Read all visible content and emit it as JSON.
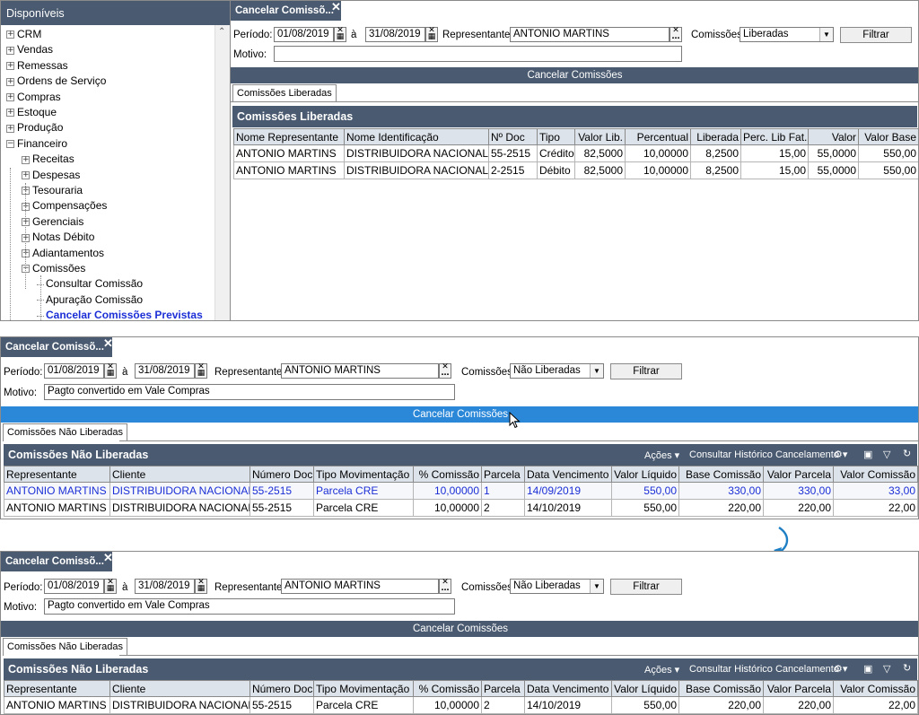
{
  "tree": {
    "header": "Disponíveis",
    "items": [
      {
        "label": "CRM",
        "level": 0,
        "exp": "+"
      },
      {
        "label": "Vendas",
        "level": 0,
        "exp": "+"
      },
      {
        "label": "Remessas",
        "level": 0,
        "exp": "+"
      },
      {
        "label": "Ordens de Serviço",
        "level": 0,
        "exp": "+"
      },
      {
        "label": "Compras",
        "level": 0,
        "exp": "+"
      },
      {
        "label": "Estoque",
        "level": 0,
        "exp": "+"
      },
      {
        "label": "Produção",
        "level": 0,
        "exp": "+"
      },
      {
        "label": "Financeiro",
        "level": 0,
        "exp": "−"
      },
      {
        "label": "Receitas",
        "level": 1,
        "exp": "+"
      },
      {
        "label": "Despesas",
        "level": 1,
        "exp": "+"
      },
      {
        "label": "Tesouraria",
        "level": 1,
        "exp": "+"
      },
      {
        "label": "Compensações",
        "level": 1,
        "exp": "+"
      },
      {
        "label": "Gerenciais",
        "level": 1,
        "exp": "+"
      },
      {
        "label": "Notas Débito",
        "level": 1,
        "exp": "+"
      },
      {
        "label": "Adiantamentos",
        "level": 1,
        "exp": "+"
      },
      {
        "label": "Comissões",
        "level": 1,
        "exp": "−"
      },
      {
        "label": "Consultar Comissão",
        "level": 2,
        "exp": ""
      },
      {
        "label": "Apuração Comissão",
        "level": 2,
        "exp": ""
      },
      {
        "label": "Cancelar Comissões Previstas",
        "level": 2,
        "exp": "",
        "active": true
      }
    ]
  },
  "panel1": {
    "tab_title": "Cancelar Comissõ...",
    "periodo_label": "Período:",
    "date_from": "01/08/2019",
    "a_label": "à",
    "date_to": "31/08/2019",
    "rep_label": "Representante:",
    "rep_value": "ANTONIO MARTINS",
    "comissoes_label": "Comissões:",
    "comissoes_value": "Liberadas",
    "filtrar": "Filtrar",
    "motivo_label": "Motivo:",
    "motivo_value": "",
    "cancel_bar": "Cancelar Comissões",
    "subtab": "Comissões Liberadas",
    "grid_title": "Comissões Liberadas",
    "columns": [
      "Nome Representante",
      "Nome Identificação",
      "Nº Doc",
      "Tipo",
      "Valor Lib.",
      "Percentual",
      "Liberada",
      "Perc. Lib Fat.",
      "Valor",
      "Valor Base"
    ],
    "rows": [
      [
        "ANTONIO MARTINS",
        "DISTRIBUIDORA NACIONAL",
        "55-2515",
        "Crédito",
        "82,5000",
        "10,00000",
        "8,2500",
        "15,00",
        "55,0000",
        "550,00"
      ],
      [
        "ANTONIO MARTINS",
        "DISTRIBUIDORA NACIONAL",
        "2-2515",
        "Débito",
        "82,5000",
        "10,00000",
        "8,2500",
        "15,00",
        "55,0000",
        "550,00"
      ]
    ]
  },
  "panel2": {
    "tab_title": "Cancelar Comissõ...",
    "periodo_label": "Período:",
    "date_from": "01/08/2019",
    "a_label": "à",
    "date_to": "31/08/2019",
    "rep_label": "Representante:",
    "rep_value": "ANTONIO MARTINS",
    "comissoes_label": "Comissões:",
    "comissoes_value": "Não Liberadas",
    "filtrar": "Filtrar",
    "motivo_label": "Motivo:",
    "motivo_value": "Pagto convertido em Vale Compras",
    "cancel_bar": "Cancelar Comissões",
    "subtab": "Comissões Não Liberadas",
    "grid_title": "Comissões Não Liberadas",
    "acoes": "Ações ▾",
    "historico": "Consultar Histórico Cancelamento",
    "columns": [
      "Representante",
      "Cliente",
      "Número Doc",
      "Tipo Movimentação",
      "% Comissão",
      "Parcela",
      "Data Vencimento",
      "Valor Líquido",
      "Base Comissão",
      "Valor Parcela",
      "Valor Comissão"
    ],
    "rows": [
      [
        "ANTONIO MARTINS",
        "DISTRIBUIDORA NACIONAL",
        "55-2515",
        "Parcela CRE",
        "10,00000",
        "1",
        "14/09/2019",
        "550,00",
        "330,00",
        "330,00",
        "33,00"
      ],
      [
        "ANTONIO MARTINS",
        "DISTRIBUIDORA NACIONAL",
        "55-2515",
        "Parcela CRE",
        "10,00000",
        "2",
        "14/10/2019",
        "550,00",
        "220,00",
        "220,00",
        "22,00"
      ]
    ]
  },
  "panel3": {
    "tab_title": "Cancelar Comissõ...",
    "periodo_label": "Período:",
    "date_from": "01/08/2019",
    "a_label": "à",
    "date_to": "31/08/2019",
    "rep_label": "Representante:",
    "rep_value": "ANTONIO MARTINS",
    "comissoes_label": "Comissões:",
    "comissoes_value": "Não Liberadas",
    "filtrar": "Filtrar",
    "motivo_label": "Motivo:",
    "motivo_value": "Pagto convertido em Vale Compras",
    "cancel_bar": "Cancelar Comissões",
    "subtab": "Comissões Não Liberadas",
    "grid_title": "Comissões Não Liberadas",
    "acoes": "Ações ▾",
    "historico": "Consultar Histórico Cancelamento",
    "columns": [
      "Representante",
      "Cliente",
      "Número Doc",
      "Tipo Movimentação",
      "% Comissão",
      "Parcela",
      "Data Vencimento",
      "Valor Líquido",
      "Base Comissão",
      "Valor Parcela",
      "Valor Comissão"
    ],
    "rows": [
      [
        "ANTONIO MARTINS",
        "DISTRIBUIDORA NACIONAL",
        "55-2515",
        "Parcela CRE",
        "10,00000",
        "2",
        "14/10/2019",
        "550,00",
        "220,00",
        "220,00",
        "22,00"
      ]
    ]
  },
  "colors": {
    "header": "#4a5a70",
    "accent": "#2b88d8",
    "selected_text": "#1c2fd6",
    "arrow": "#1f7fc4"
  }
}
